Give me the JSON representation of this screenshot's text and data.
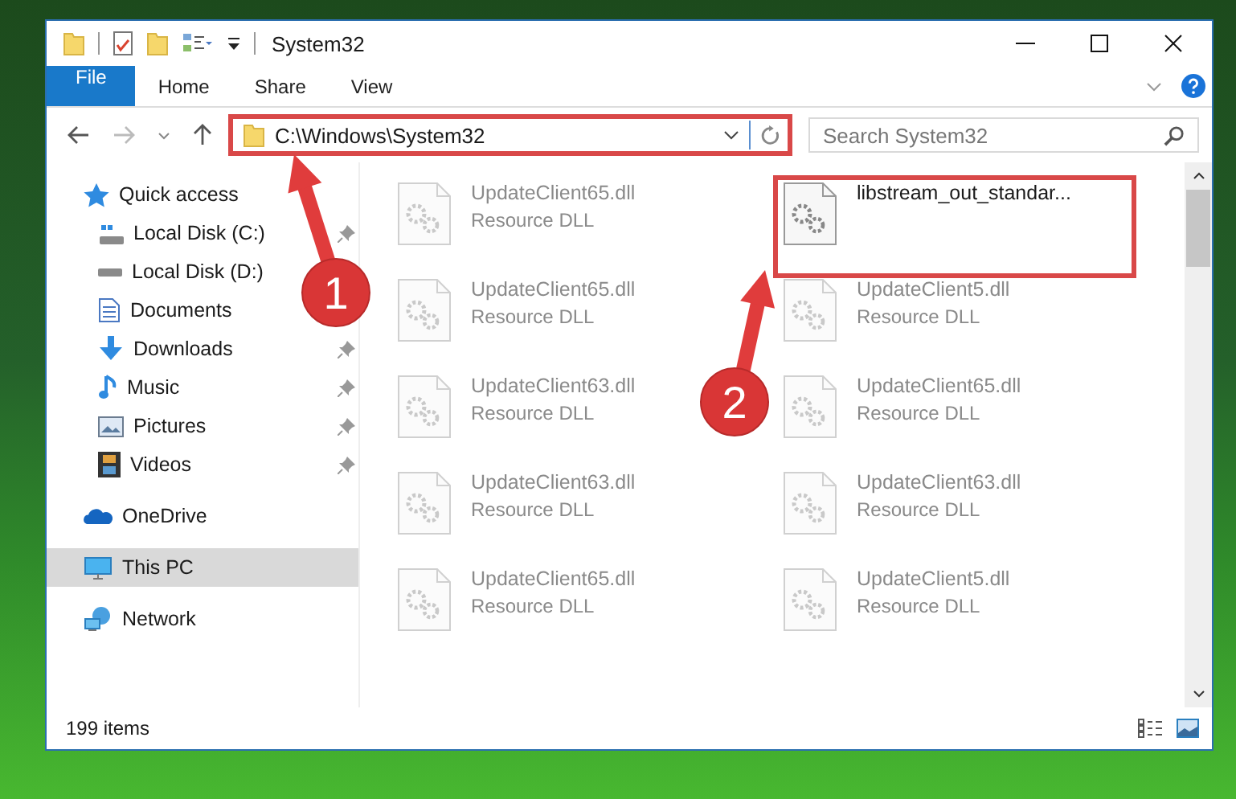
{
  "window": {
    "title": "System32"
  },
  "ribbon_tabs": [
    {
      "label": "File",
      "kind": "file"
    },
    {
      "label": "Home",
      "kind": "tab"
    },
    {
      "label": "Share",
      "kind": "tab"
    },
    {
      "label": "View",
      "kind": "tab"
    }
  ],
  "address_bar": {
    "path": "C:\\Windows\\System32"
  },
  "search": {
    "placeholder": "Search System32"
  },
  "sidebar": {
    "items": [
      {
        "label": "Quick access",
        "kind": "star",
        "selected": false,
        "children": [
          {
            "label": "Local Disk (C:)",
            "kind": "system-drive",
            "pinned": true,
            "selected": false
          },
          {
            "label": "Local Disk (D:)",
            "kind": "drive",
            "selected": false
          },
          {
            "label": "Documents",
            "kind": "documents",
            "selected": false
          },
          {
            "label": "Downloads",
            "kind": "downloads",
            "pinned": true,
            "selected": false
          },
          {
            "label": "Music",
            "kind": "music",
            "pinned": true,
            "selected": false
          },
          {
            "label": "Pictures",
            "kind": "pictures",
            "pinned": true,
            "selected": false
          },
          {
            "label": "Videos",
            "kind": "videos",
            "pinned": true,
            "selected": false
          }
        ]
      },
      {
        "label": "OneDrive",
        "kind": "cloud",
        "selected": false
      },
      {
        "label": "This PC",
        "kind": "computer",
        "selected": true
      },
      {
        "label": "Network",
        "kind": "network",
        "selected": false
      }
    ]
  },
  "files": [
    {
      "name": "UpdateClient65.dll",
      "type": "Resource DLL",
      "faded": true,
      "highlighted": false
    },
    {
      "name": "libstream_out_standar...",
      "faded": false,
      "highlighted": true
    },
    {
      "name": "UpdateClient65.dll",
      "type": "Resource DLL",
      "faded": true,
      "highlighted": false
    },
    {
      "name": "UpdateClient5.dll",
      "type": "Resource DLL",
      "faded": true,
      "highlighted": false
    },
    {
      "name": "UpdateClient63.dll",
      "type": "Resource DLL",
      "faded": true,
      "highlighted": false
    },
    {
      "name": "UpdateClient65.dll",
      "type": "Resource DLL",
      "faded": true,
      "highlighted": false
    },
    {
      "name": "UpdateClient63.dll",
      "type": "Resource DLL",
      "faded": true,
      "highlighted": false
    },
    {
      "name": "UpdateClient63.dll",
      "type": "Resource DLL",
      "faded": true,
      "highlighted": false
    },
    {
      "name": "UpdateClient65.dll",
      "type": "Resource DLL",
      "faded": true,
      "highlighted": false
    },
    {
      "name": "UpdateClient5.dll",
      "type": "Resource DLL",
      "faded": true,
      "highlighted": false
    }
  ],
  "status_bar": {
    "item_count": "199 items"
  },
  "annotations": [
    {
      "label": "1"
    },
    {
      "label": "2"
    }
  ]
}
